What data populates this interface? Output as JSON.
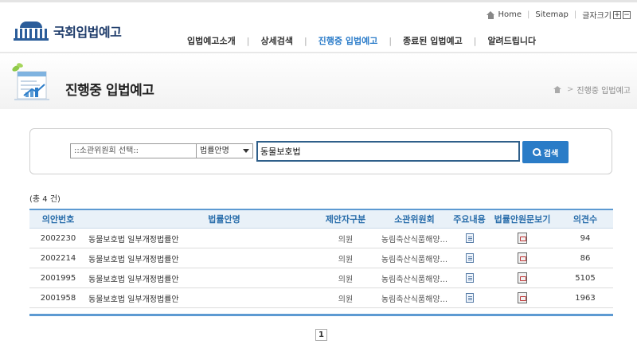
{
  "header": {
    "logo_text": "국회입법예고",
    "util": {
      "home_label": "Home",
      "sitemap_label": "Sitemap",
      "fontsize_label": "글자크기",
      "zoom_in": "+",
      "zoom_out": "−"
    },
    "nav": [
      {
        "label": "입법예고소개",
        "active": false
      },
      {
        "label": "상세검색",
        "active": false
      },
      {
        "label": "진행중 입법예고",
        "active": true
      },
      {
        "label": "종료된 입법예고",
        "active": false
      },
      {
        "label": "알려드립니다",
        "active": false
      }
    ],
    "nav_divider": "|"
  },
  "page": {
    "title": "진행중 입법예고",
    "breadcrumb_current": "진행중 입법예고",
    "breadcrumb_sep": ">"
  },
  "search": {
    "committee_select": "::소관위원회 선택::",
    "field_select": "법률안명",
    "query": "동물보호법",
    "button_label": "검색"
  },
  "results": {
    "count_text": "(총 4 건)",
    "columns": [
      "의안번호",
      "법률안명",
      "제안자구분",
      "소관위원회",
      "주요내용",
      "법률안원문보기",
      "의견수"
    ],
    "rows": [
      {
        "bill_no": "2002230",
        "title": "동물보호법 일부개정법률안",
        "proposer": "의원",
        "committee": "농림축산식품해양...",
        "opinions": "94"
      },
      {
        "bill_no": "2002214",
        "title": "동물보호법 일부개정법률안",
        "proposer": "의원",
        "committee": "농림축산식품해양...",
        "opinions": "86"
      },
      {
        "bill_no": "2001995",
        "title": "동물보호법 일부개정법률안",
        "proposer": "의원",
        "committee": "농림축산식품해양...",
        "opinions": "5105"
      },
      {
        "bill_no": "2001958",
        "title": "동물보호법 일부개정법률안",
        "proposer": "의원",
        "committee": "농림축산식품해양...",
        "opinions": "1963"
      }
    ]
  },
  "pagination": {
    "current_page": "1"
  },
  "colors": {
    "accent": "#2a7cc7",
    "header_blue": "#2a6eab",
    "logo_blue": "#2b5d9a"
  }
}
